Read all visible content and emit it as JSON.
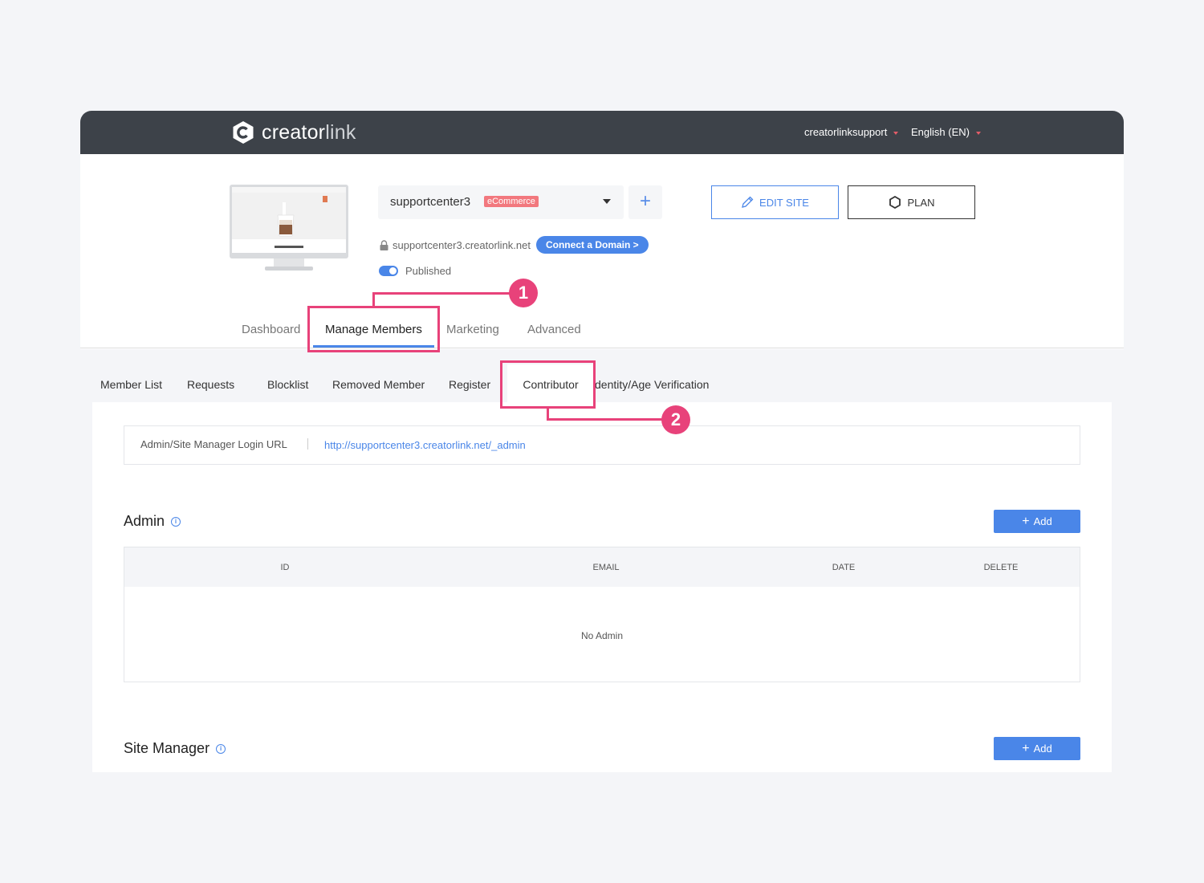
{
  "header": {
    "brand_main": "creator",
    "brand_rest": "link",
    "user": "creatorlinksupport",
    "language": "English (EN)"
  },
  "site": {
    "name": "supportcenter3",
    "badge": "eCommerce",
    "plus": "+",
    "domain": "supportcenter3.creatorlink.net",
    "connect_label": "Connect a Domain >",
    "status": "Published"
  },
  "actions": {
    "edit": "EDIT SITE",
    "plan": "PLAN"
  },
  "tabs": {
    "dashboard": "Dashboard",
    "manage": "Manage Members",
    "marketing": "Marketing",
    "advanced": "Advanced"
  },
  "subtabs": {
    "member_list": "Member List",
    "requests": "Requests",
    "blocklist": "Blocklist",
    "removed": "Removed Member",
    "register": "Register",
    "contributor": "Contributor",
    "identity": "dentity/Age Verification"
  },
  "login_url": {
    "label": "Admin/Site Manager Login URL",
    "url": "http://supportcenter3.creatorlink.net/_admin"
  },
  "admin": {
    "title": "Admin",
    "info": "i",
    "add_plus": "+",
    "add": "Add",
    "columns": {
      "id": "ID",
      "email": "EMAIL",
      "date": "DATE",
      "delete": "DELETE"
    },
    "empty": "No Admin"
  },
  "site_manager": {
    "title": "Site Manager",
    "info": "i",
    "add_plus": "+",
    "add": "Add"
  },
  "annotations": {
    "one": "1",
    "two": "2",
    "color": "#e8427a"
  },
  "colors": {
    "topbar": "#3d4249",
    "accent": "#4a86e8",
    "badge": "#f2787e"
  }
}
